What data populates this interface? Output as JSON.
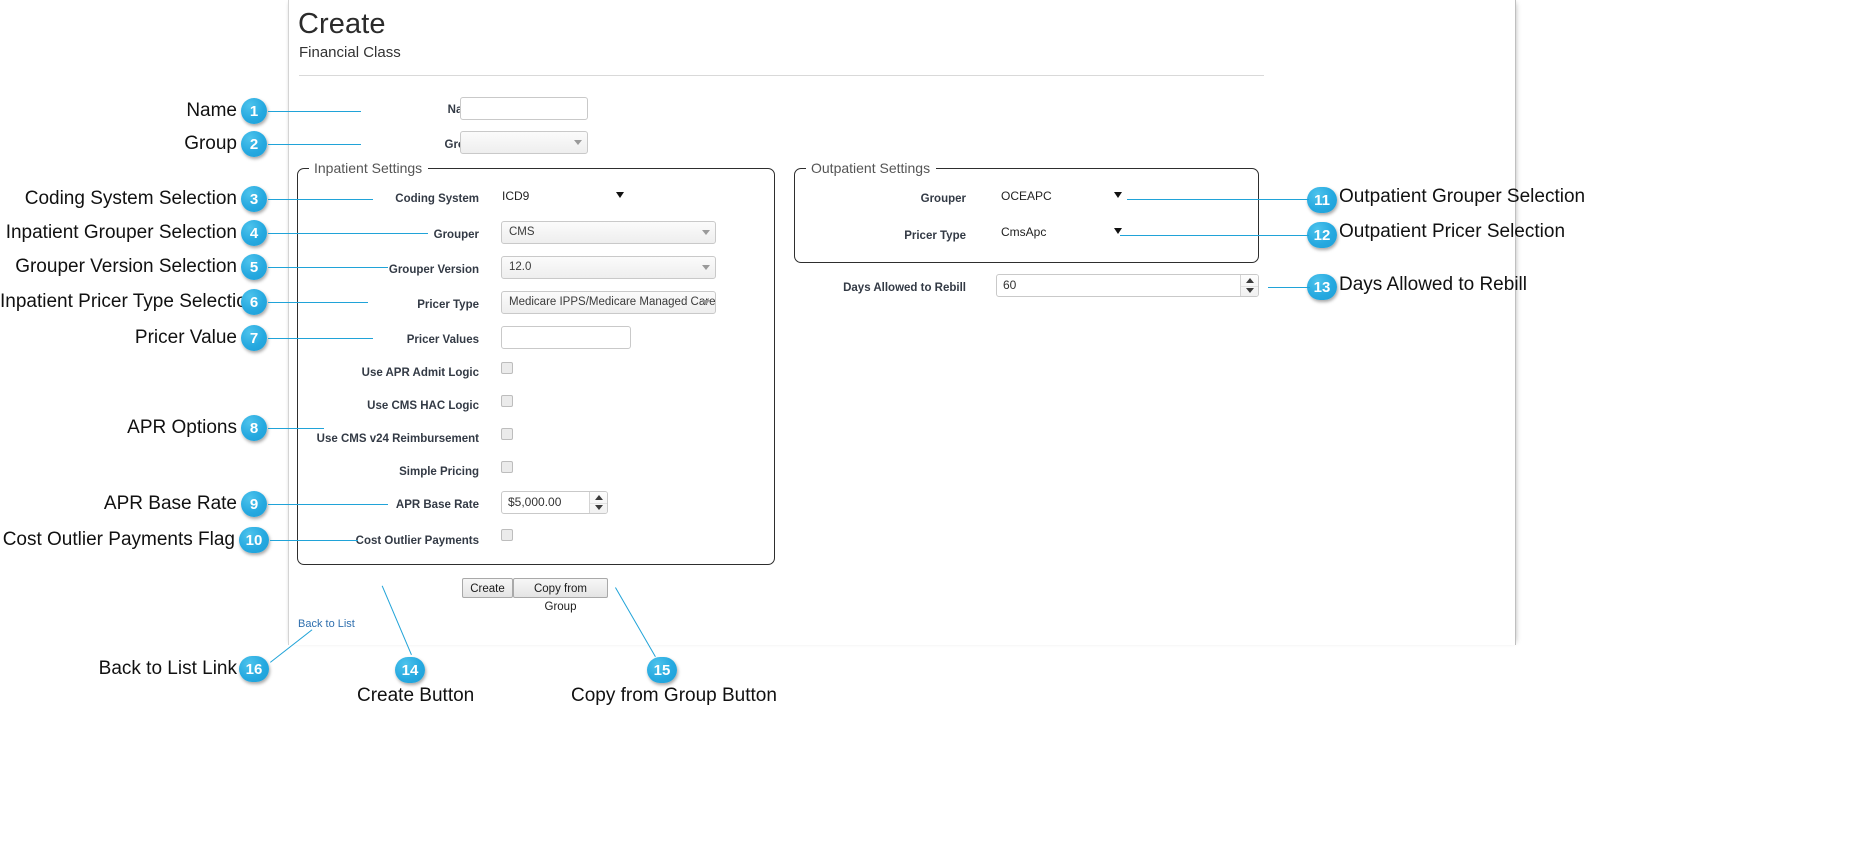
{
  "page": {
    "title": "Create",
    "subtitle": "Financial Class"
  },
  "form": {
    "name_label": "Name",
    "name_value": "",
    "name_placeholder": "",
    "group_label": "Group",
    "group_value": "",
    "inpatient": {
      "legend": "Inpatient Settings",
      "coding_system_label": "Coding System",
      "coding_system_value": "ICD9",
      "grouper_label": "Grouper",
      "grouper_value": "CMS",
      "grouper_version_label": "Grouper Version",
      "grouper_version_value": "12.0",
      "pricer_type_label": "Pricer Type",
      "pricer_type_value": "Medicare IPPS/Medicare Managed Care",
      "pricer_values_label": "Pricer Values",
      "pricer_values_value": "",
      "use_apr_admit_logic_label": "Use APR Admit Logic",
      "use_cms_hac_logic_label": "Use CMS HAC Logic",
      "use_cms_v24_label": "Use CMS v24 Reimbursement",
      "simple_pricing_label": "Simple Pricing",
      "apr_base_rate_label": "APR Base Rate",
      "apr_base_rate_value": "$5,000.00",
      "cost_outlier_payments_label": "Cost Outlier Payments"
    },
    "outpatient": {
      "legend": "Outpatient Settings",
      "grouper_label": "Grouper",
      "grouper_value": "OCEAPC",
      "pricer_type_label": "Pricer Type",
      "pricer_type_value": "CmsApc"
    },
    "days_allowed_label": "Days Allowed to Rebill",
    "days_allowed_value": "60",
    "create_button": "Create",
    "copy_from_group_button": "Copy from Group",
    "back_to_list_link": "Back to List"
  },
  "annotations": {
    "accent_color": "#26a9e0",
    "left": [
      {
        "n": "1",
        "label": "Name"
      },
      {
        "n": "2",
        "label": "Group"
      },
      {
        "n": "3",
        "label": "Coding System Selection"
      },
      {
        "n": "4",
        "label": "Inpatient Grouper Selection"
      },
      {
        "n": "5",
        "label": "Grouper Version Selection"
      },
      {
        "n": "6",
        "label": "Inpatient Pricer Type Selection"
      },
      {
        "n": "7",
        "label": "Pricer Value"
      },
      {
        "n": "8",
        "label": "APR Options"
      },
      {
        "n": "9",
        "label": "APR Base Rate"
      },
      {
        "n": "10",
        "label": "Cost Outlier Payments Flag"
      },
      {
        "n": "16",
        "label": "Back to List Link"
      }
    ],
    "right": [
      {
        "n": "11",
        "label": "Outpatient Grouper Selection"
      },
      {
        "n": "12",
        "label": "Outpatient Pricer Selection"
      },
      {
        "n": "13",
        "label": "Days Allowed to Rebill"
      }
    ],
    "bottom": [
      {
        "n": "14",
        "label": "Create Button"
      },
      {
        "n": "15",
        "label": "Copy from Group Button"
      }
    ]
  }
}
